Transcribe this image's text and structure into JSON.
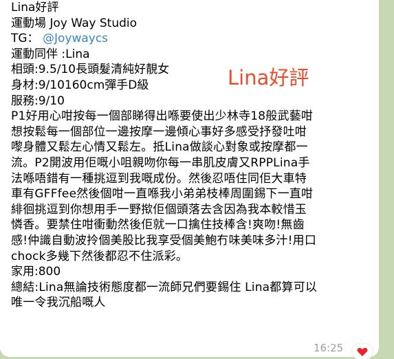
{
  "message": {
    "lines": [
      "Lina好評",
      "運動場   Joy Way Studio",
      "運動同伴 :Lina",
      "相頭:9.5/10長頭髮清純好靚女",
      "身材:9/10160cm彈手D級",
      "服務:9/10"
    ],
    "tg_label": "TG：",
    "tg_link": "@Joywaycs",
    "paragraph_lines": [
      "P1好用心咁按每一個部睇得出喺要使出少林寺18般武藝咁",
      "想按鬆每一個部位一邊按摩一邊傾心事好多感受抒發吐咁",
      "嚟身體又鬆左心情又鬆左。抵Lina做談心對象或按摩都一",
      "流。P2開波用佢嘅小咀親吻你每一串肌皮膚又RPPLina手",
      "法喺唔錯有一種挑逗到我嘅成份。然後忍唔住同佢大車特",
      "車有GFFfee然後個咁一直喺我小弟弟枝棒周圍錫下一直咁",
      "緋徊挑逗到你想用手一野揿佢個頭落去含因為我本較惜玉",
      "憐香。要禁住咁衝動然後佢就一口擒住技棒含!爽吻!無齒",
      "感!仲識自動波拎個美股比我享受個美鮑冇味美味多汁!用口",
      "chock多幾下然後都忍不住派彩。"
    ],
    "price_line": "家用:800",
    "summary_lines": [
      "總結:Lina無論技術態度都一流師兄們要錫住 Lina都算可以",
      "唯一令我沉船嘅人"
    ],
    "overlay_title": "Lina好評",
    "time": "16:25",
    "reaction_icon": "heart-icon"
  },
  "colors": {
    "background": "#c7d8b4",
    "bubble": "#ffffff",
    "text": "#000000",
    "link": "#3a85c7",
    "overlay_title": "#ee4b2b",
    "time": "#9aa39a",
    "heart": "#e8252c"
  }
}
